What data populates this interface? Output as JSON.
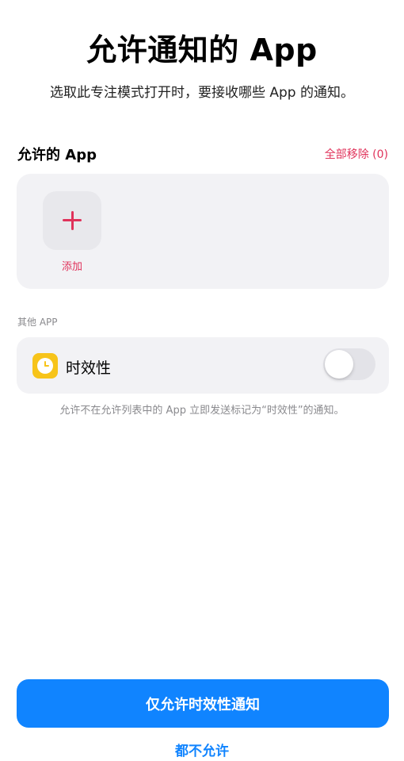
{
  "header": {
    "title": "允许通知的 App",
    "subtitle": "选取此专注模式打开时，要接收哪些 App 的通知。"
  },
  "allowed_apps": {
    "section_title": "允许的 App",
    "remove_all_label": "全部移除 (0)",
    "add_label": "添加",
    "accent_color": "#e0325a"
  },
  "other_apps": {
    "section_label": "其他 APP",
    "time_sensitive": {
      "label": "时效性",
      "icon": "clock-icon",
      "enabled": false
    },
    "footnote": "允许不在允许列表中的 App 立即发送标记为“时效性”的通知。"
  },
  "actions": {
    "primary_label": "仅允许时效性通知",
    "secondary_label": "都不允许",
    "primary_color": "#1084ff"
  }
}
